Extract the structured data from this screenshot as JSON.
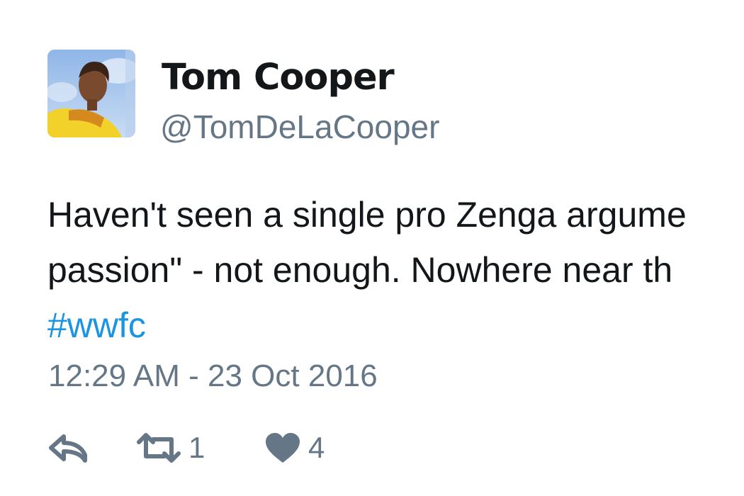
{
  "tweet": {
    "author": {
      "display_name": "Tom Cooper",
      "handle": "@TomDeLaCooper"
    },
    "text_lines": [
      "Haven't seen a single pro Zenga argume",
      "passion\" - not enough. Nowhere near th"
    ],
    "hashtag": "#wwfc",
    "timestamp": "12:29 AM - 23 Oct 2016",
    "actions": {
      "reply": {
        "icon": "reply-icon"
      },
      "retweet": {
        "icon": "retweet-icon",
        "count": "1"
      },
      "like": {
        "icon": "heart-icon",
        "count": "4"
      }
    },
    "colors": {
      "text": "#14171a",
      "secondary": "#657786",
      "link": "#1b95e0"
    }
  }
}
